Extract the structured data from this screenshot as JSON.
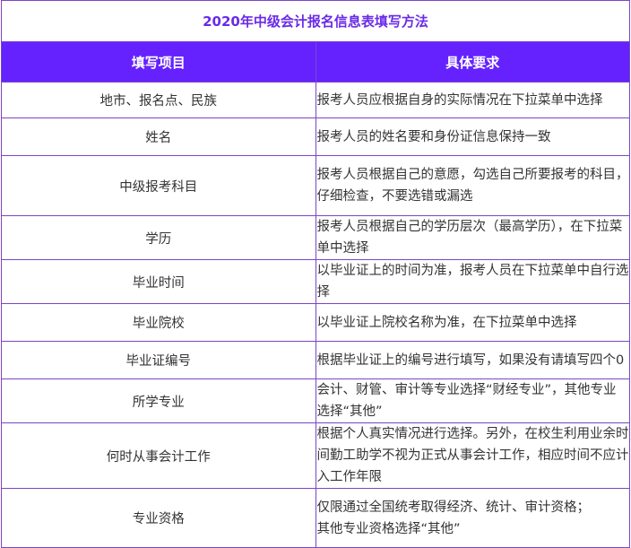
{
  "title": "2020年中级会计报名信息表填写方法",
  "headers": {
    "item": "填写项目",
    "requirement": "具体要求"
  },
  "rows": [
    {
      "item": "地市、报名点、民族",
      "requirement": [
        "报考人员应根据自身的实际情况在下拉菜单中选择"
      ]
    },
    {
      "item": "姓名",
      "requirement": [
        "报考人员的姓名要和身份证信息保持一致"
      ]
    },
    {
      "item": "中级报考科目",
      "requirement": [
        "报考人员根据自己的意愿，勾选自己所要报考的科目，仔细检查，不要选错或漏选"
      ]
    },
    {
      "item": "学历",
      "requirement": [
        "报考人员根据自己的学历层次（最高学历），在下拉菜单中选择"
      ]
    },
    {
      "item": "毕业时间",
      "requirement": [
        "以毕业证上的时间为准，报考人员在下拉菜单中自行选择"
      ]
    },
    {
      "item": "毕业院校",
      "requirement": [
        "以毕业证上院校名称为准，在下拉菜单中选择"
      ]
    },
    {
      "item": "毕业证编号",
      "requirement": [
        "根据毕业证上的编号进行填写，如果没有请填写四个0"
      ]
    },
    {
      "item": "所学专业",
      "requirement": [
        "会计、财管、审计等专业选择“财经专业”，其他专业选择“其他”"
      ]
    },
    {
      "item": "何时从事会计工作",
      "requirement": [
        "根据个人真实情况进行选择。另外，在校生利用业余时间勤工助学不视为正式从事会计工作，相应时间不应计入工作年限"
      ]
    },
    {
      "item": "专业资格",
      "requirement": [
        "仅限通过全国统考取得经济、统计、审计资格；",
        "其他专业资格选择“其他”"
      ]
    }
  ]
}
